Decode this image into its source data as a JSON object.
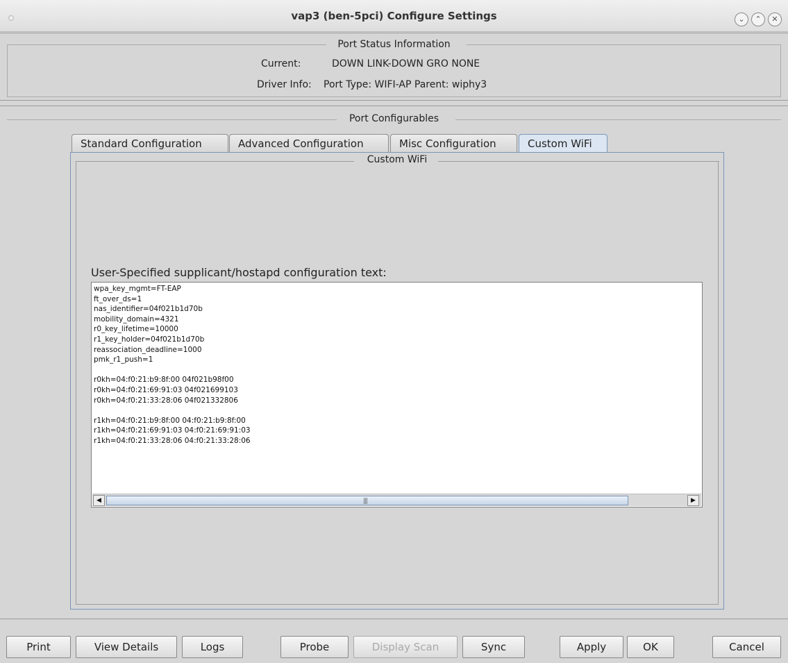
{
  "window": {
    "title": "vap3  (ben-5pci) Configure Settings"
  },
  "port_status": {
    "group_title": "Port Status Information",
    "current_label": "Current:",
    "current_value": "DOWN LINK-DOWN GRO  NONE",
    "driver_label": "Driver Info:",
    "driver_value": "Port Type: WIFI-AP   Parent: wiphy3"
  },
  "configurables": {
    "group_title": "Port Configurables",
    "tabs": [
      {
        "label": "Standard Configuration",
        "active": false
      },
      {
        "label": "Advanced Configuration",
        "active": false
      },
      {
        "label": "Misc Configuration",
        "active": false
      },
      {
        "label": "Custom WiFi",
        "active": true
      }
    ],
    "custom_wifi": {
      "group_title": "Custom WiFi",
      "text_label": "User-Specified supplicant/hostapd configuration text:",
      "config_lines": [
        "wpa_key_mgmt=FT-EAP",
        "ft_over_ds=1",
        "nas_identifier=04f021b1d70b",
        "mobility_domain=4321",
        "r0_key_lifetime=10000",
        "r1_key_holder=04f021b1d70b",
        "reassociation_deadline=1000",
        "pmk_r1_push=1",
        "",
        "r0kh=04:f0:21:b9:8f:00 04f021b98f00",
        "r0kh=04:f0:21:69:91:03 04f021699103",
        "r0kh=04:f0:21:33:28:06 04f021332806",
        "",
        "r1kh=04:f0:21:b9:8f:00 04:f0:21:b9:8f:00",
        "r1kh=04:f0:21:69:91:03 04:f0:21:69:91:03",
        "r1kh=04:f0:21:33:28:06 04:f0:21:33:28:06"
      ]
    }
  },
  "buttons": {
    "print": "Print",
    "view_details": "View Details",
    "logs": "Logs",
    "probe": "Probe",
    "display_scan": "Display Scan",
    "sync": "Sync",
    "apply": "Apply",
    "ok": "OK",
    "cancel": "Cancel"
  },
  "icons": {
    "minimize": "chevron-down-icon",
    "maximize": "chevron-up-icon",
    "close": "close-icon",
    "scroll_left": "arrow-left-icon",
    "scroll_right": "arrow-right-icon"
  },
  "colors": {
    "active_tab": "#dce6f2",
    "tab_border": "#7a96b9"
  }
}
